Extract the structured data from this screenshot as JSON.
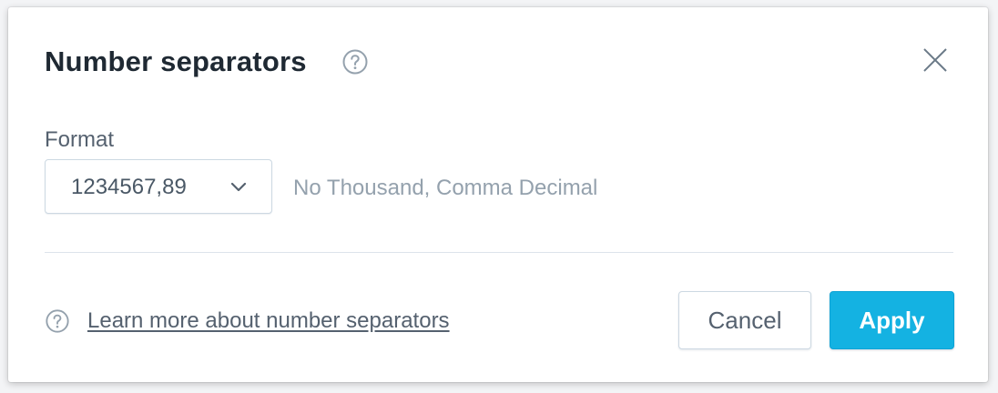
{
  "dialog": {
    "title": "Number separators",
    "help_icon": "question-circle-icon",
    "close_icon": "close-icon"
  },
  "format": {
    "label": "Format",
    "selected_value": "1234567,89",
    "dropdown_icon": "chevron-down-icon",
    "description": "No Thousand, Comma Decimal"
  },
  "footer": {
    "help_icon": "question-circle-icon",
    "learn_more_link": "Learn more about number separators",
    "cancel_label": "Cancel",
    "apply_label": "Apply"
  },
  "colors": {
    "primary": "#14b2e2",
    "text": "#1f2933",
    "muted": "#94a1ad",
    "border": "#ccd8e2"
  }
}
